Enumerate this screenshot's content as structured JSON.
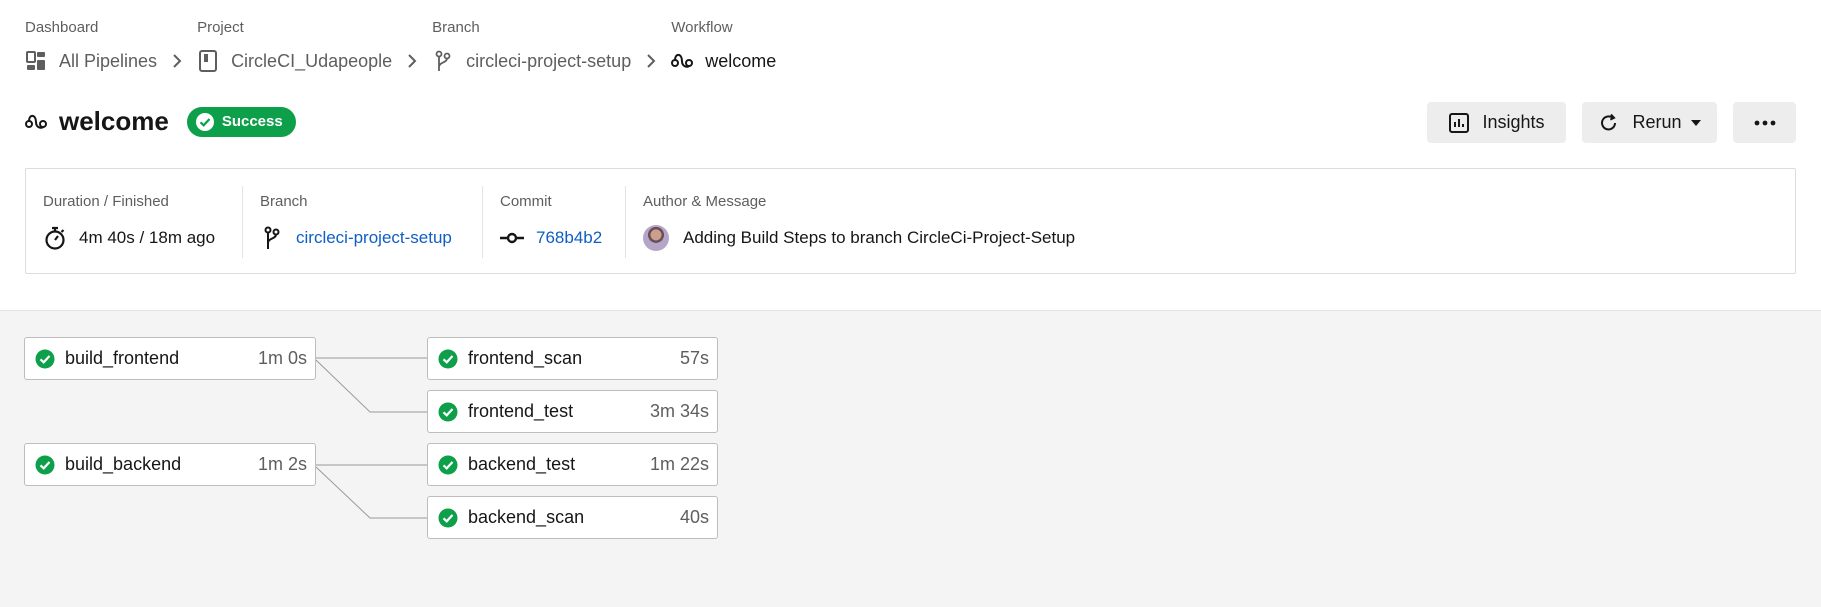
{
  "breadcrumb": [
    {
      "label": "Dashboard",
      "value": "All Pipelines",
      "icon": "dashboard-icon"
    },
    {
      "label": "Project",
      "value": "CircleCI_Udapeople",
      "icon": "repo-icon"
    },
    {
      "label": "Branch",
      "value": "circleci-project-setup",
      "icon": "branch-icon"
    },
    {
      "label": "Workflow",
      "value": "welcome",
      "icon": "workflow-icon"
    }
  ],
  "header": {
    "title": "welcome",
    "status": "Success",
    "status_color": "#0d9f4a"
  },
  "actions": {
    "insights": "Insights",
    "rerun": "Rerun",
    "more": "more-icon"
  },
  "summary": {
    "duration_label": "Duration / Finished",
    "duration_value": "4m 40s / 18m ago",
    "branch_label": "Branch",
    "branch_value": "circleci-project-setup",
    "commit_label": "Commit",
    "commit_value": "768b4b2",
    "author_label": "Author & Message",
    "author_message": "Adding Build Steps to branch CircleCi-Project-Setup"
  },
  "jobs": [
    {
      "name": "build_frontend",
      "duration": "1m 0s",
      "status": "success"
    },
    {
      "name": "frontend_scan",
      "duration": "57s",
      "status": "success"
    },
    {
      "name": "frontend_test",
      "duration": "3m 34s",
      "status": "success"
    },
    {
      "name": "build_backend",
      "duration": "1m 2s",
      "status": "success"
    },
    {
      "name": "backend_test",
      "duration": "1m 22s",
      "status": "success"
    },
    {
      "name": "backend_scan",
      "duration": "40s",
      "status": "success"
    }
  ],
  "colors": {
    "success": "#0d9f4a",
    "link": "#0f5ec7"
  }
}
